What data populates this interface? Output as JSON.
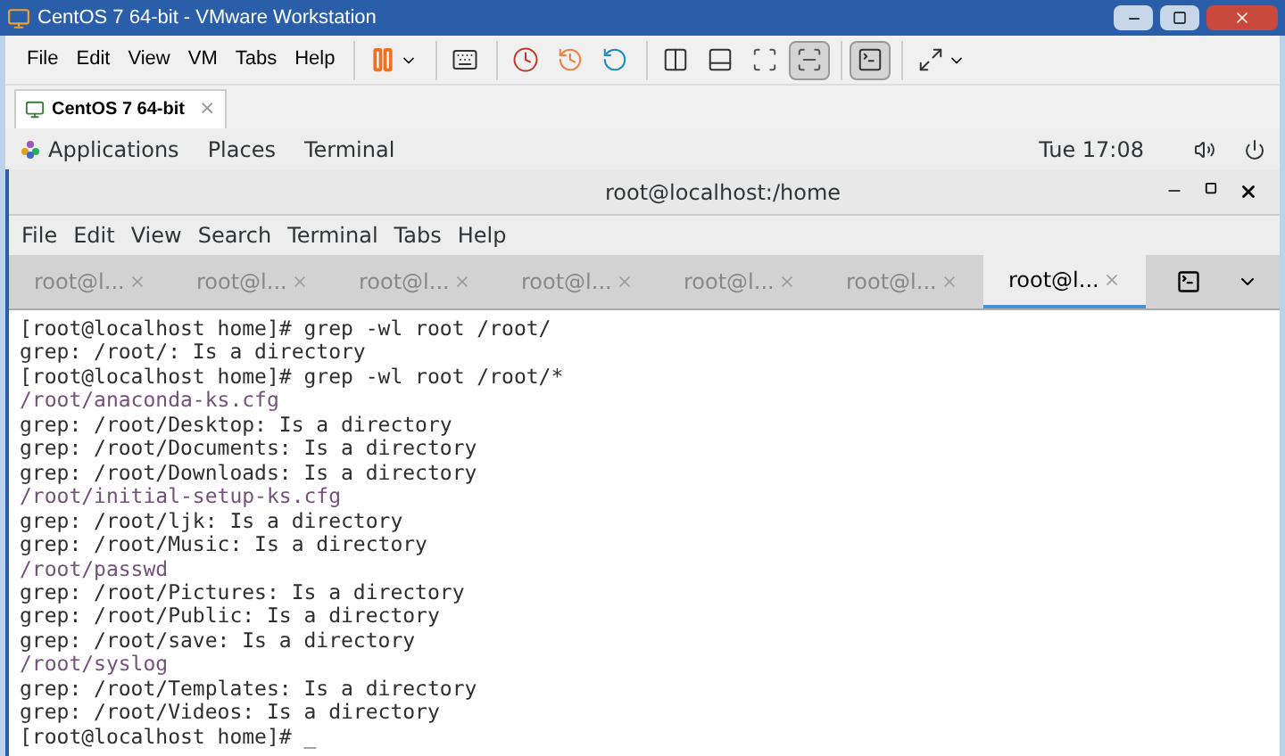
{
  "window": {
    "title": "CentOS 7 64-bit - VMware Workstation"
  },
  "menu": [
    "File",
    "Edit",
    "View",
    "VM",
    "Tabs",
    "Help"
  ],
  "toolbar": [
    [
      {
        "kind": "pause",
        "pressed": false
      }
    ],
    [
      {
        "kind": "send",
        "pressed": false
      }
    ],
    [
      {
        "kind": "snap",
        "pressed": false
      },
      {
        "kind": "revert",
        "pressed": false
      },
      {
        "kind": "manage",
        "pressed": false
      }
    ],
    [
      {
        "kind": "library",
        "pressed": false
      },
      {
        "kind": "thumb",
        "pressed": false
      },
      {
        "kind": "fit",
        "pressed": false
      },
      {
        "kind": "nofit",
        "pressed": true
      }
    ],
    [
      {
        "kind": "console",
        "pressed": true
      }
    ],
    [
      {
        "kind": "full",
        "pressed": false
      }
    ]
  ],
  "vm_tab": {
    "label": "CentOS 7 64-bit",
    "close": "×"
  },
  "gnome_bar": {
    "items": [
      "Applications",
      "Places",
      "Terminal"
    ],
    "clock": "Tue 17:08"
  },
  "terminal": {
    "title": "root@localhost:/home",
    "menu": [
      "File",
      "Edit",
      "View",
      "Search",
      "Terminal",
      "Tabs",
      "Help"
    ],
    "tabs": [
      {
        "label": "root@l...",
        "selected": false
      },
      {
        "label": "root@l...",
        "selected": false
      },
      {
        "label": "root@l...",
        "selected": false
      },
      {
        "label": "root@l...",
        "selected": false
      },
      {
        "label": "root@l...",
        "selected": false
      },
      {
        "label": "root@l...",
        "selected": false
      },
      {
        "label": "root@l...",
        "selected": true
      }
    ],
    "lines": [
      {
        "kind": "text",
        "text": "[root@localhost home]# grep -wl root /root/"
      },
      {
        "kind": "text",
        "text": "grep: /root/: Is a directory"
      },
      {
        "kind": "text",
        "text": "[root@localhost home]# grep -wl root /root/*"
      },
      {
        "kind": "file",
        "text": "/root/anaconda-ks.cfg"
      },
      {
        "kind": "text",
        "text": "grep: /root/Desktop: Is a directory"
      },
      {
        "kind": "text",
        "text": "grep: /root/Documents: Is a directory"
      },
      {
        "kind": "text",
        "text": "grep: /root/Downloads: Is a directory"
      },
      {
        "kind": "file",
        "text": "/root/initial-setup-ks.cfg"
      },
      {
        "kind": "text",
        "text": "grep: /root/ljk: Is a directory"
      },
      {
        "kind": "text",
        "text": "grep: /root/Music: Is a directory"
      },
      {
        "kind": "file",
        "text": "/root/passwd"
      },
      {
        "kind": "text",
        "text": "grep: /root/Pictures: Is a directory"
      },
      {
        "kind": "text",
        "text": "grep: /root/Public: Is a directory"
      },
      {
        "kind": "text",
        "text": "grep: /root/save: Is a directory"
      },
      {
        "kind": "file",
        "text": "/root/syslog"
      },
      {
        "kind": "text",
        "text": "grep: /root/Templates: Is a directory"
      },
      {
        "kind": "text",
        "text": "grep: /root/Videos: Is a directory"
      },
      {
        "kind": "text",
        "text": "[root@localhost home]# _"
      }
    ]
  }
}
